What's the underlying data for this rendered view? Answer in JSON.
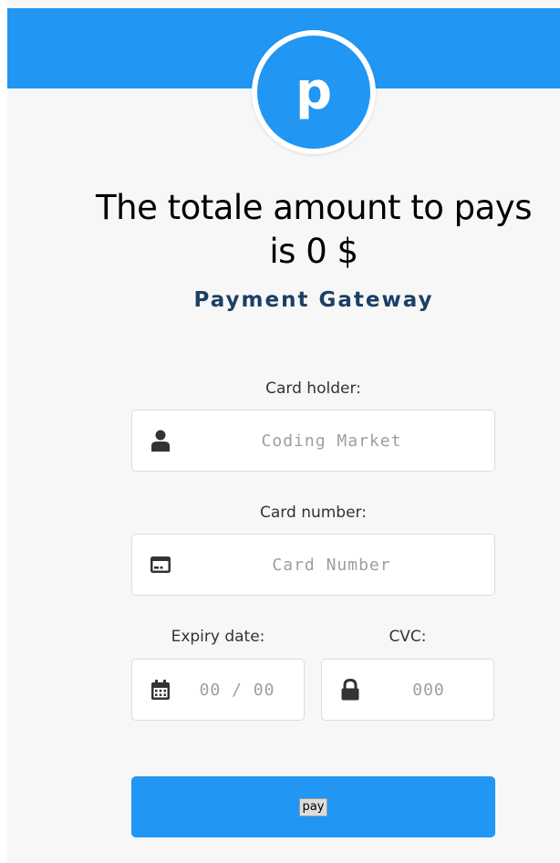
{
  "brand": {
    "logo_letter": "p"
  },
  "header": {
    "title": "The totale amount to pays is 0 $",
    "subtitle": "Payment Gateway"
  },
  "form": {
    "card_holder": {
      "label": "Card holder:",
      "placeholder": "Coding Market",
      "icon": "user-icon"
    },
    "card_number": {
      "label": "Card number:",
      "placeholder": "Card Number",
      "icon": "credit-card-icon"
    },
    "expiry": {
      "label": "Expiry date:",
      "placeholder": "00 / 00",
      "icon": "calendar-icon"
    },
    "cvc": {
      "label": "CVC:",
      "placeholder": "000",
      "icon": "lock-icon"
    },
    "submit_label": "pay"
  },
  "colors": {
    "accent": "#2196f3",
    "subtitle": "#1c3f66",
    "icon": "#333333",
    "placeholder": "#9e9e9e"
  }
}
